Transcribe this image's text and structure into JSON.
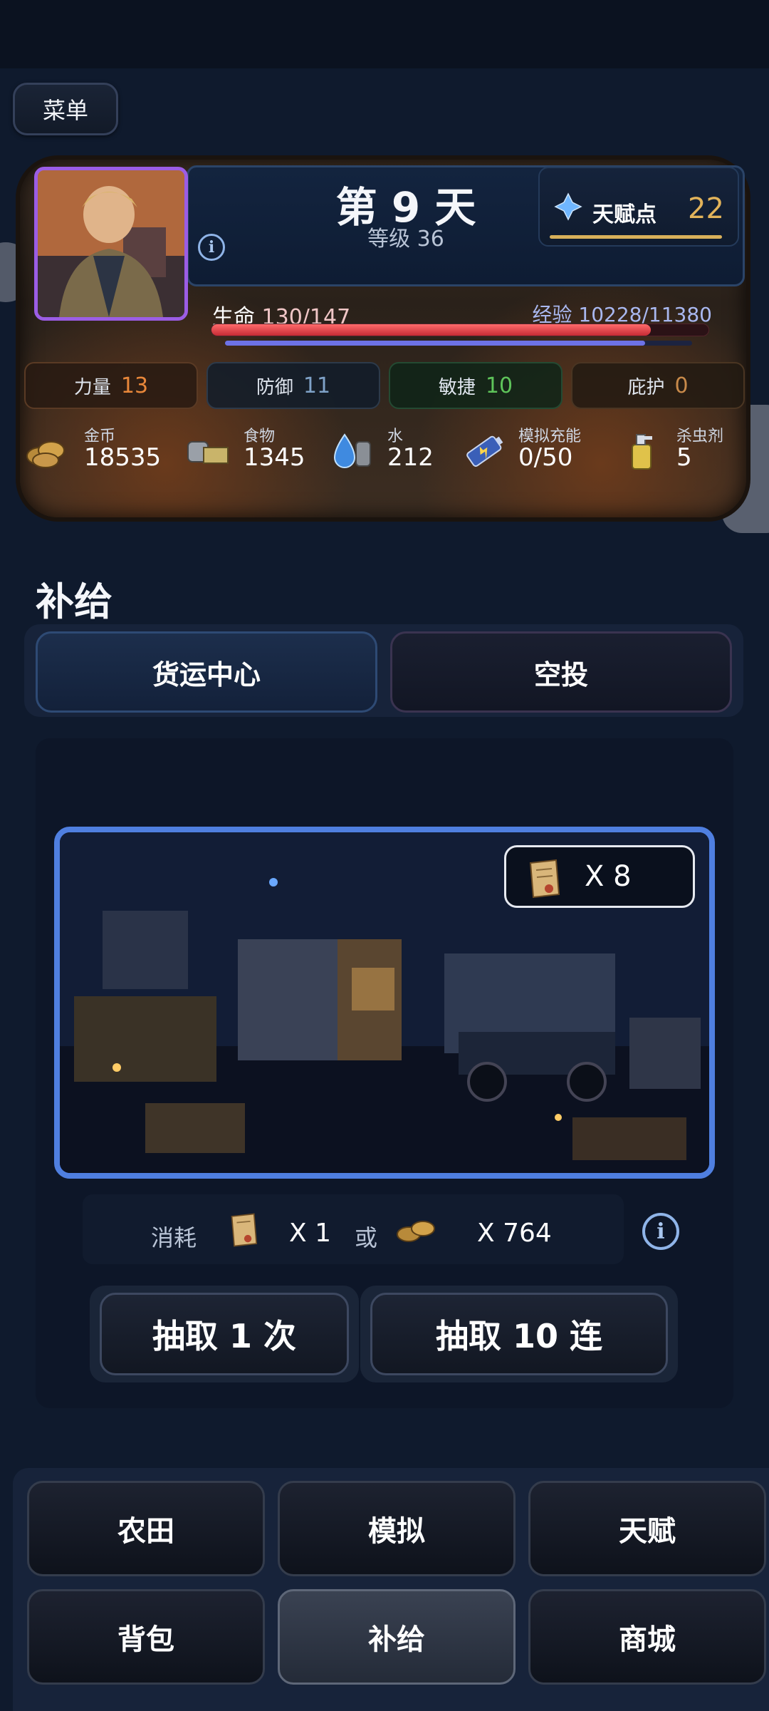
{
  "menu_label": "菜单",
  "status": {
    "day_title": "第 9 天",
    "level": "等级 36",
    "talent_label": "天赋点",
    "talent_value": "22",
    "hp_label": "生命",
    "hp_value": "130/147",
    "hp_fraction": 0.884,
    "xp_label": "经验",
    "xp_value": "10228/11380",
    "xp_fraction": 0.899
  },
  "stats": [
    {
      "label": "力量",
      "value": "13",
      "color": "#e8873a"
    },
    {
      "label": "防御",
      "value": "11",
      "color": "#7fa2c8"
    },
    {
      "label": "敏捷",
      "value": "10",
      "color": "#5ec45a"
    },
    {
      "label": "庇护",
      "value": "0",
      "color": "#c88a4a"
    }
  ],
  "resources": [
    {
      "label": "金币",
      "value": "18535",
      "icon": "coins-icon"
    },
    {
      "label": "食物",
      "value": "1345",
      "icon": "food-icon"
    },
    {
      "label": "水",
      "value": "212",
      "icon": "water-icon"
    },
    {
      "label": "模拟充能",
      "value": "0/50",
      "icon": "battery-icon"
    },
    {
      "label": "杀虫剂",
      "value": "5",
      "icon": "spray-icon"
    }
  ],
  "section_title": "补给",
  "tabs": [
    {
      "label": "货运中心",
      "active": true
    },
    {
      "label": "空投",
      "active": false
    }
  ],
  "ticket_count": "X 8",
  "cost": {
    "label": "消耗",
    "ticket_amount": "X 1",
    "or_text": "或",
    "gold_amount": "X 764"
  },
  "draw_buttons": [
    "抽取 1 次",
    "抽取 10 连"
  ],
  "nav": [
    "农田",
    "模拟",
    "天赋",
    "背包",
    "补给",
    "商城"
  ],
  "nav_active": "补给"
}
